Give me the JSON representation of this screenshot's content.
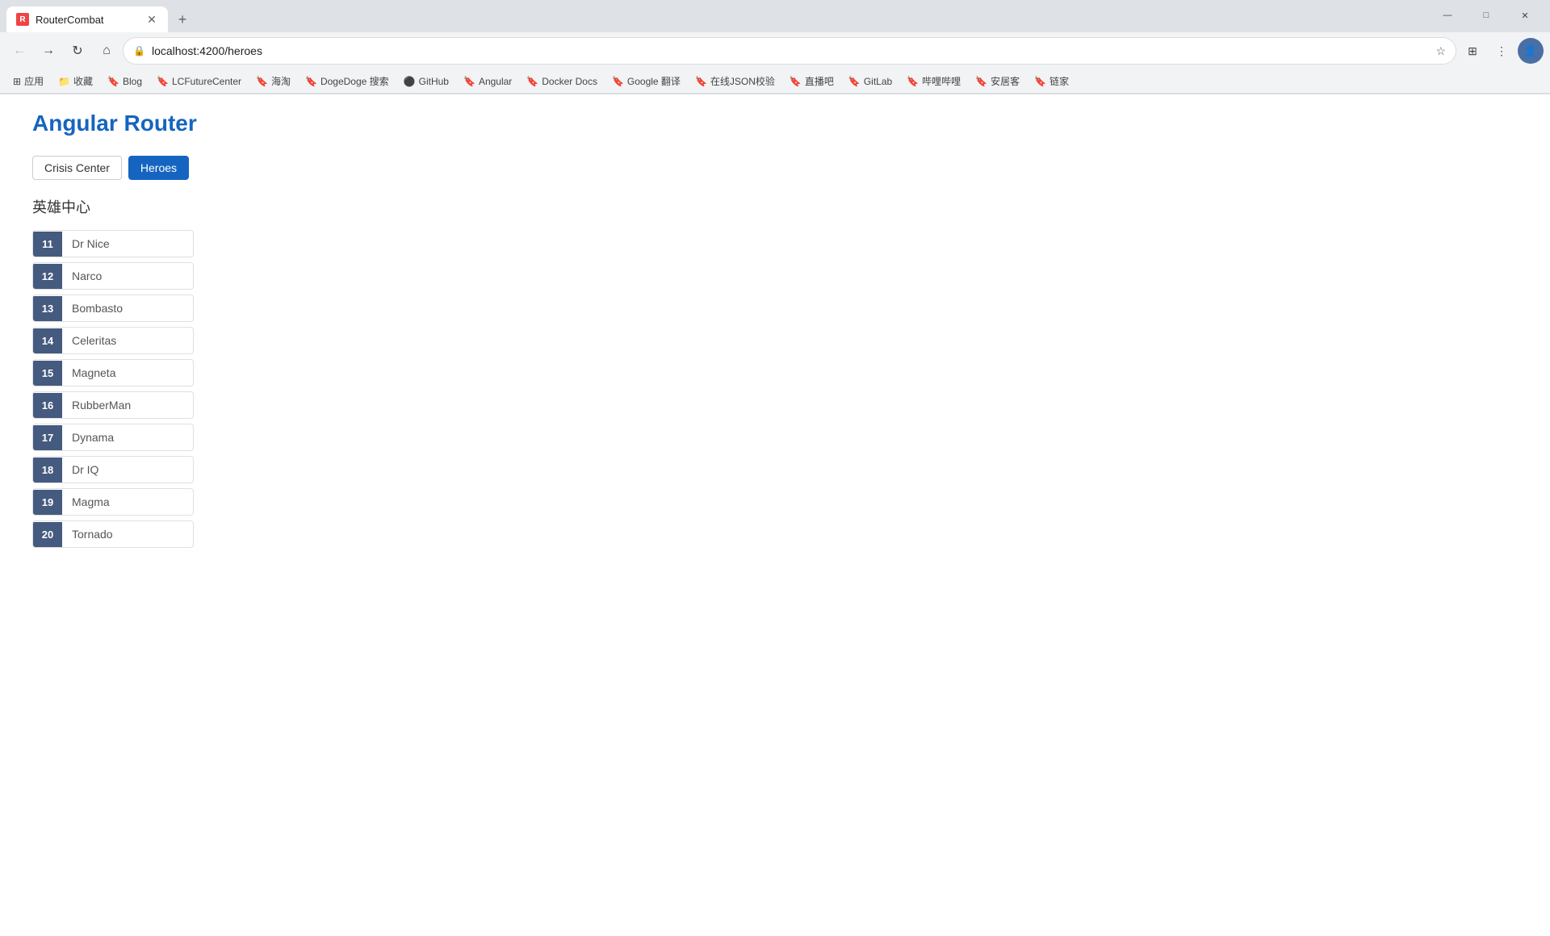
{
  "browser": {
    "tab": {
      "favicon_text": "R",
      "title": "RouterCombat"
    },
    "url": "localhost:4200/heroes",
    "new_tab_label": "+",
    "window_controls": {
      "minimize": "—",
      "maximize": "□",
      "close": "✕"
    }
  },
  "bookmarks": [
    {
      "id": "apps",
      "icon": "⊞",
      "label": "应用"
    },
    {
      "id": "downloads",
      "icon": "📁",
      "label": "收藏"
    },
    {
      "id": "blog",
      "icon": "🔖",
      "label": "Blog"
    },
    {
      "id": "lcfuture",
      "icon": "🔖",
      "label": "LCFutureCenter"
    },
    {
      "id": "haihai",
      "icon": "🔖",
      "label": "海淘"
    },
    {
      "id": "dogedoge",
      "icon": "🔖",
      "label": "DogeDoge 搜索"
    },
    {
      "id": "github",
      "icon": "⚫",
      "label": "GitHub"
    },
    {
      "id": "angular",
      "icon": "🔖",
      "label": "Angular"
    },
    {
      "id": "docker",
      "icon": "🐳",
      "label": "Docker Docs"
    },
    {
      "id": "google-translate",
      "icon": "🔖",
      "label": "Google 翻译"
    },
    {
      "id": "json",
      "icon": "🔖",
      "label": "在线JSON校验"
    },
    {
      "id": "zhibo",
      "icon": "🔖",
      "label": "直播吧"
    },
    {
      "id": "gitlab",
      "icon": "🔖",
      "label": "GitLab"
    },
    {
      "id": "bibi",
      "icon": "🔖",
      "label": "哔哩哔哩"
    },
    {
      "id": "anjushu",
      "icon": "🔖",
      "label": "安居客"
    },
    {
      "id": "lianjia",
      "icon": "🔖",
      "label": "链家"
    }
  ],
  "page": {
    "title": "Angular Router",
    "tabs": [
      {
        "id": "crisis",
        "label": "Crisis Center",
        "active": false
      },
      {
        "id": "heroes",
        "label": "Heroes",
        "active": true
      }
    ],
    "section_title": "英雄中心",
    "heroes": [
      {
        "id": 11,
        "name": "Dr Nice"
      },
      {
        "id": 12,
        "name": "Narco"
      },
      {
        "id": 13,
        "name": "Bombasto"
      },
      {
        "id": 14,
        "name": "Celeritas"
      },
      {
        "id": 15,
        "name": "Magneta"
      },
      {
        "id": 16,
        "name": "RubberMan"
      },
      {
        "id": 17,
        "name": "Dynama"
      },
      {
        "id": 18,
        "name": "Dr IQ"
      },
      {
        "id": 19,
        "name": "Magma"
      },
      {
        "id": 20,
        "name": "Tornado"
      }
    ]
  }
}
